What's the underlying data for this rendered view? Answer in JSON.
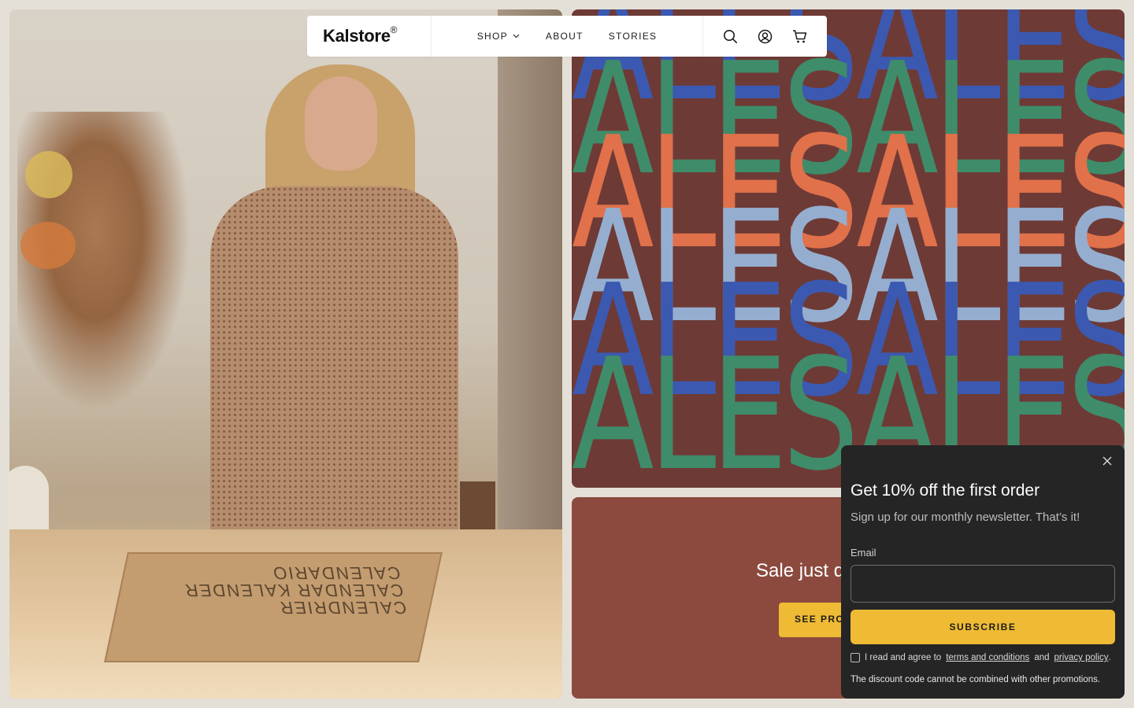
{
  "header": {
    "logo_text": "Kalstore",
    "logo_mark": "®",
    "nav": [
      {
        "label": "SHOP",
        "icon": "chevron-down-icon"
      },
      {
        "label": "ABOUT"
      },
      {
        "label": "STORIES"
      }
    ],
    "icons": [
      "search-icon",
      "account-icon",
      "cart-icon"
    ]
  },
  "hero_left": {
    "box_text": "CALENDRIER CALENDAR KALENDER CALENDARIO"
  },
  "sale_banner": {
    "word": "ALESALESALESAL",
    "colors": [
      "#3b59b0",
      "#3f8c6a",
      "#e0714a",
      "#95aecf",
      "#3b59b0",
      "#3f8c6a"
    ],
    "background": "#6e3a36"
  },
  "promo": {
    "title": "Sale just d",
    "button_label": "SEE PRO"
  },
  "newsletter": {
    "title": "Get 10% off the first order",
    "subtitle": "Sign up for our monthly newsletter. That’s it!",
    "email_label": "Email",
    "email_value": "",
    "email_placeholder": "",
    "subscribe_label": "SUBSCRIBE",
    "consent_prefix": "I read and agree to",
    "terms_link": "terms and conditions",
    "consent_and": "and",
    "privacy_link": "privacy policy",
    "consent_suffix": ".",
    "disclaimer": "The discount code cannot be combined with other promotions."
  },
  "colors": {
    "accent_yellow": "#efbb34",
    "popup_bg": "#252525",
    "promo_bg": "#8c4a3f"
  }
}
